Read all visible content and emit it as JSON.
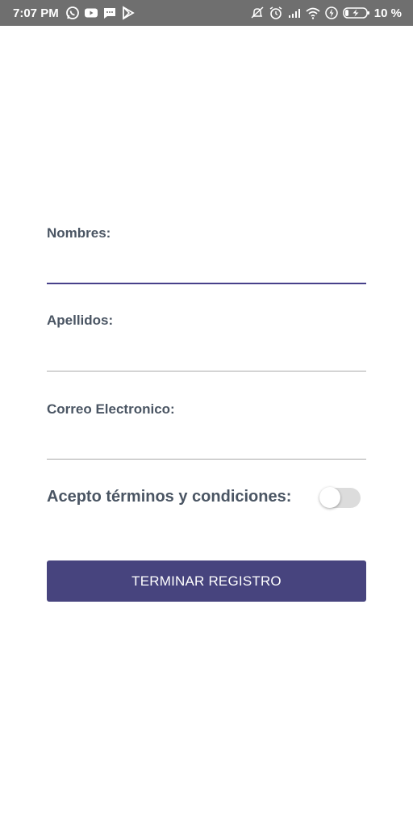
{
  "status_bar": {
    "time": "7:07 PM",
    "battery_percent": "10 %",
    "left_icons": [
      "whatsapp-icon",
      "youtube-icon",
      "message-icon",
      "play-store-icon"
    ],
    "right_icons": [
      "bell-off-icon",
      "alarm-icon",
      "signal-icon",
      "wifi-icon",
      "charging-icon",
      "battery-icon"
    ]
  },
  "form": {
    "nombres": {
      "label": "Nombres:",
      "value": ""
    },
    "apellidos": {
      "label": "Apellidos:",
      "value": ""
    },
    "correo": {
      "label": "Correo Electronico:",
      "value": ""
    },
    "terms": {
      "label": "Acepto términos y condiciones:",
      "checked": false
    },
    "submit_label": "TERMINAR REGISTRO"
  },
  "colors": {
    "status_bar": "#6f6f6f",
    "label": "#4a5563",
    "accent": "#47418a",
    "button": "#47447e",
    "underline": "#a9a9a9",
    "switch_track": "#dcdcdc"
  }
}
